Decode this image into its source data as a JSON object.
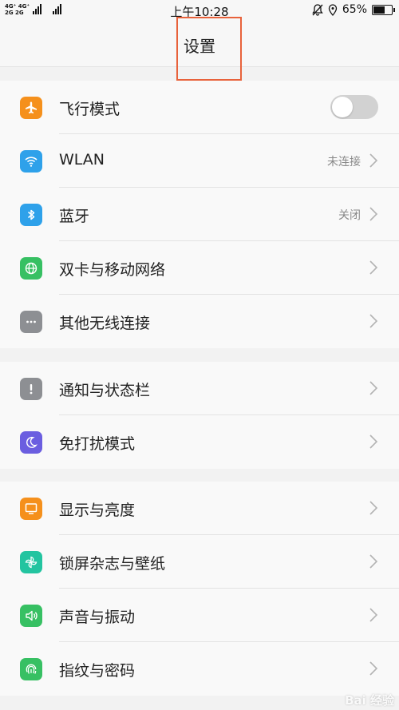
{
  "status_bar": {
    "network_top": "4G⁺ 4G⁺",
    "network_bottom": "2G 2G",
    "time": "上午10:28",
    "battery": "65%",
    "battery_level": 0.65
  },
  "header": {
    "title": "设置"
  },
  "groups": [
    {
      "items": [
        {
          "label": "飞行模式",
          "control": "toggle",
          "toggle_on": false,
          "icon": "airplane-icon",
          "color": "#f5901c"
        },
        {
          "label": "WLAN",
          "status": "未连接",
          "icon": "wifi-icon",
          "color": "#2ea1ea"
        },
        {
          "label": "蓝牙",
          "status": "关闭",
          "icon": "bluetooth-icon",
          "color": "#2ea1ea"
        },
        {
          "label": "双卡与移动网络",
          "status": "",
          "icon": "globe-icon",
          "color": "#37c063"
        },
        {
          "label": "其他无线连接",
          "status": "",
          "icon": "more-icon",
          "color": "#8d8f93"
        }
      ]
    },
    {
      "items": [
        {
          "label": "通知与状态栏",
          "status": "",
          "icon": "notification-icon",
          "color": "#8d8f93"
        },
        {
          "label": "免打扰模式",
          "status": "",
          "icon": "moon-icon",
          "color": "#6b5ee0"
        }
      ]
    },
    {
      "items": [
        {
          "label": "显示与亮度",
          "status": "",
          "icon": "display-icon",
          "color": "#f5901c"
        },
        {
          "label": "锁屏杂志与壁纸",
          "status": "",
          "icon": "pinwheel-icon",
          "color": "#23c4a0"
        },
        {
          "label": "声音与振动",
          "status": "",
          "icon": "speaker-icon",
          "color": "#37c063"
        },
        {
          "label": "指纹与密码",
          "status": "",
          "icon": "fingerprint-icon",
          "color": "#37c063"
        }
      ]
    }
  ],
  "watermark": "Bai 经验"
}
